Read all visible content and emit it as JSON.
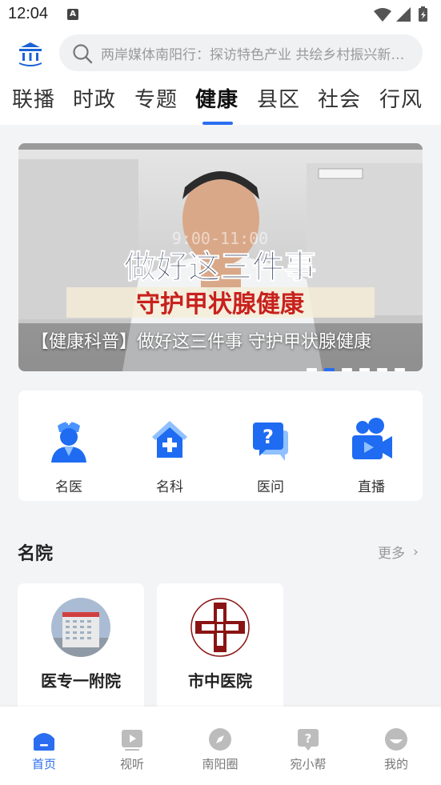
{
  "status_bar": {
    "time": "12:04",
    "notification_letter": "A"
  },
  "search": {
    "placeholder": "两岸媒体南阳行：探访特色产业 共绘乡村振兴新画卷"
  },
  "tabs": [
    {
      "label": "联播"
    },
    {
      "label": "时政"
    },
    {
      "label": "专题"
    },
    {
      "label": "健康",
      "active": true
    },
    {
      "label": "县区"
    },
    {
      "label": "社会"
    },
    {
      "label": "行风"
    }
  ],
  "banner": {
    "caption": "【健康科普】做好这三件事 守护甲状腺健康",
    "overlay_line1": "做好这三件事",
    "overlay_line2": "守护甲状腺健康",
    "clock_text": "9:00-11:00",
    "active_slide": 2,
    "slide_count": 6
  },
  "quick_entries": [
    {
      "label": "名医",
      "icon": "doctor-icon"
    },
    {
      "label": "名科",
      "icon": "hospital-department-icon"
    },
    {
      "label": "医问",
      "icon": "question-chat-icon"
    },
    {
      "label": "直播",
      "icon": "live-camera-icon"
    }
  ],
  "hospitals_section": {
    "title": "名院",
    "more_label": "更多",
    "items": [
      {
        "name": "医专一附院",
        "image": "hospital-building-photo"
      },
      {
        "name": "市中医院",
        "image": "hospital-logo"
      }
    ]
  },
  "bottom_nav": [
    {
      "label": "首页",
      "icon": "home-icon",
      "active": true
    },
    {
      "label": "视听",
      "icon": "video-play-icon"
    },
    {
      "label": "南阳圈",
      "icon": "compass-icon"
    },
    {
      "label": "宛小帮",
      "icon": "help-question-icon"
    },
    {
      "label": "我的",
      "icon": "profile-icon"
    }
  ],
  "colors": {
    "accent": "#2a6df0",
    "background": "#f3f4f6",
    "card": "#ffffff"
  }
}
